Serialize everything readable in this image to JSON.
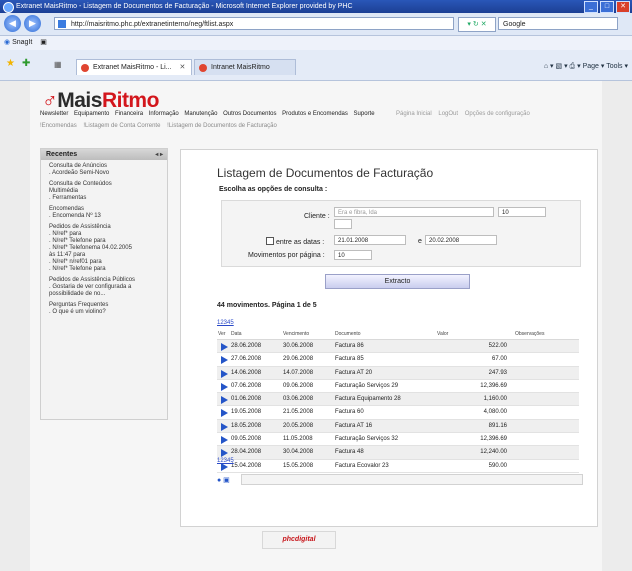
{
  "window": {
    "title": "Extranet MaisRitmo - Listagem de Documentos de Facturação - Microsoft Internet Explorer provided by PHC"
  },
  "browser": {
    "url": "http://maisritmo.phc.pt/extranetinterno/neg/ftlist.aspx",
    "search_placeholder": "Google",
    "snagit_label": "SnagIt",
    "tabs": [
      {
        "label": "Extranet MaisRitmo - Li...",
        "close": "✕"
      },
      {
        "label": "Intranet MaisRitmo"
      }
    ],
    "commands": "Page ▾  Tools ▾"
  },
  "site": {
    "logo_text_a": "Mais",
    "logo_text_b": "Ritmo",
    "menu": [
      "Newsletter",
      "Equipamento",
      "Financeira",
      "Informação",
      "Manutenção",
      "Outros Documentos",
      "Produtos e Encomendas",
      "Suporte"
    ],
    "submenu": [
      "!Encomendas",
      "!Listagem de Conta Corrente",
      "!Listagem de Documentos de Facturação"
    ],
    "right_links": [
      "Página Inicial",
      "LogOut",
      "Opções de configuração"
    ]
  },
  "sidebar": {
    "title": "Recentes",
    "sections": [
      [
        "Consulta de Anúncios",
        ". Acordeão Semi-Novo"
      ],
      [
        "Consulta de Conteúdos",
        "Multimédia",
        ". Ferramentas"
      ],
      [
        "Encomendas",
        ". Encomenda Nº 13"
      ],
      [
        "Pedidos de Assistência",
        ". N/ref* para",
        ". N/ref* Telefone para",
        ". N/ref* Telefonema 04.02.2005",
        "às 11:47 para",
        ". N/ref* n/ref01 para",
        ". N/ref* Telefone para"
      ],
      [
        "Pedidos de Assistência Públicos",
        ". Gostaria de ver configurada a",
        "possibilidade de no..."
      ],
      [
        "Perguntas Frequentes",
        ". O que é um violino?"
      ]
    ]
  },
  "main": {
    "title": "Listagem de Documentos de Facturação",
    "subtitle": "Escolha as opções de consulta :",
    "cliente_label": "Cliente :",
    "cliente_value": "Era e fibra, lda",
    "cliente_no": "10",
    "datas_label": "entre as datas :",
    "date_from": "21.01.2008",
    "date_sep": "e",
    "date_to": "20.02.2008",
    "movs_label": "Movimentos por página :",
    "movs_value": "10",
    "button": "Extracto",
    "summary": "44 movimentos. Página 1 de 5",
    "pager": "12345",
    "headers": [
      "Ver",
      "Data",
      "Vencimento",
      "Documento",
      "Valor",
      "Observações"
    ],
    "rows": [
      [
        "28.06.2008",
        "30.06.2008",
        "Factura 86",
        "522.00"
      ],
      [
        "27.06.2008",
        "29.06.2008",
        "Factura 85",
        "67.00"
      ],
      [
        "14.06.2008",
        "14.07.2008",
        "Factura AT 20",
        "247.93"
      ],
      [
        "07.06.2008",
        "09.06.2008",
        "Facturação Serviços 29",
        "12,396.69"
      ],
      [
        "01.06.2008",
        "03.06.2008",
        "Factura Equipamento 28",
        "1,160.00"
      ],
      [
        "19.05.2008",
        "21.05.2008",
        "Factura 60",
        "4,080.00"
      ],
      [
        "18.05.2008",
        "20.05.2008",
        "Factura AT 16",
        "891.16"
      ],
      [
        "09.05.2008",
        "11.05.2008",
        "Facturação Serviços 32",
        "12,396.69"
      ],
      [
        "28.04.2008",
        "30.04.2008",
        "Factura 48",
        "12,240.00"
      ],
      [
        "15.04.2008",
        "15.05.2008",
        "Factura Ecovalor 23",
        "590.00"
      ]
    ]
  },
  "footer": {
    "logo": "phcdigital"
  }
}
